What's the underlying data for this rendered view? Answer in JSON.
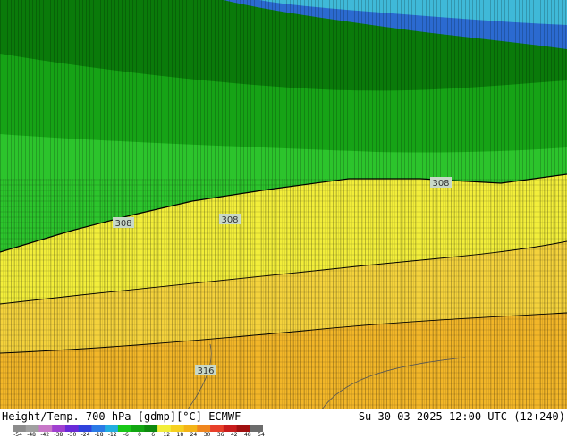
{
  "map": {
    "contour_labels": [
      "308",
      "308",
      "308",
      "316"
    ],
    "colors": {
      "green_dark": "#0a7a0a",
      "green": "#16a316",
      "green_light": "#2cc42c",
      "yellow": "#f2ee3a",
      "yellow_orange": "#f4d23c",
      "orange": "#f2b628",
      "cyan": "#3fb9d8",
      "blue": "#2b6ad0",
      "contour": "#000000"
    }
  },
  "footer": {
    "title_left": "Height/Temp. 700 hPa [gdmp][°C] ECMWF",
    "title_right": "Su 30-03-2025 12:00 UTC (12+240)"
  },
  "colorbar": {
    "ticks": [
      "-54",
      "-48",
      "-42",
      "-38",
      "-30",
      "-24",
      "-18",
      "-12",
      "-6",
      "0",
      "6",
      "12",
      "18",
      "24",
      "30",
      "36",
      "42",
      "48",
      "54"
    ],
    "colors": [
      "#8c8c8c",
      "#a0a0a0",
      "#c878c8",
      "#a040d0",
      "#6a2ad8",
      "#2f42dc",
      "#2a7ae6",
      "#22aee0",
      "#18c818",
      "#12a612",
      "#0e8a0e",
      "#f2ee3a",
      "#f6d020",
      "#f4b418",
      "#f0861e",
      "#e8402a",
      "#c81c1c",
      "#a01010",
      "#6c6c6c"
    ]
  }
}
